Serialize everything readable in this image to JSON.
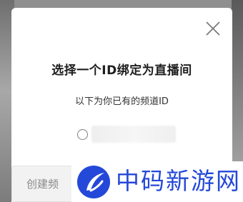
{
  "dialog": {
    "title": "选择一个ID绑定为直播间",
    "subtitle": "以下为你已有的频道ID",
    "option": {
      "id_value": ""
    },
    "create_button_label": "创建频",
    "close_icon": "close-icon"
  },
  "watermark": {
    "text": "中码新游网",
    "logo": "crescent-logo",
    "color": "#2448d8"
  }
}
